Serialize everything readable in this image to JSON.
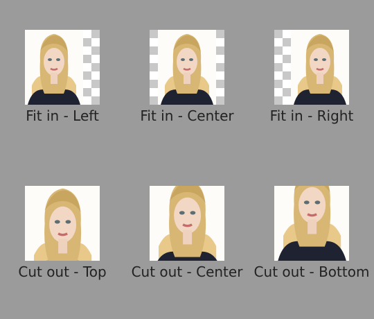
{
  "background_color": "#9b9b9b",
  "checker_colors": [
    "#ffffff",
    "#c8c8c8"
  ],
  "image_subject": "portrait-photo",
  "items": [
    {
      "label": "Fit in - Left",
      "mode": "fit-left"
    },
    {
      "label": "Fit in - Center",
      "mode": "fit-center"
    },
    {
      "label": "Fit in - Right",
      "mode": "fit-right"
    },
    {
      "label": "Cut out - Top",
      "mode": "cut-top"
    },
    {
      "label": "Cut out - Center",
      "mode": "cut-center"
    },
    {
      "label": "Cut out - Bottom",
      "mode": "cut-bottom"
    }
  ]
}
